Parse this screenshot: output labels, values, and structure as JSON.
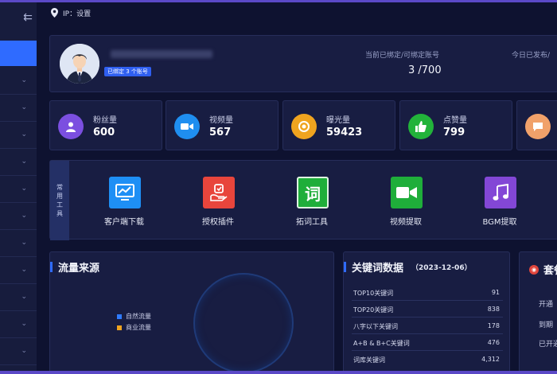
{
  "breadcrumb": {
    "text": "IP：设置"
  },
  "profile": {
    "bound_badge": "已绑定 3 个账号",
    "bind_label": "当前已绑定/可绑定账号",
    "bind_value": "3 /700",
    "today_label": "今日已发布/"
  },
  "stats": [
    {
      "label": "粉丝量",
      "value": "600",
      "color": "#7b4fe0",
      "icon": "user-icon"
    },
    {
      "label": "视频量",
      "value": "567",
      "color": "#1f8ef0",
      "icon": "video-camera-icon"
    },
    {
      "label": "曝光量",
      "value": "59423",
      "color": "#f0a41f",
      "icon": "exposure-icon"
    },
    {
      "label": "点赞量",
      "value": "799",
      "color": "#22b33a",
      "icon": "thumbs-up-icon"
    },
    {
      "label": "",
      "value": "",
      "color": "#f1a16a",
      "icon": "comment-icon"
    }
  ],
  "tools": {
    "tag": [
      "常",
      "用",
      "工",
      "具"
    ],
    "items": [
      {
        "label": "客户端下载",
        "color": "#1e8ff5",
        "icon": "chart-monitor-icon"
      },
      {
        "label": "授权插件",
        "color": "#e8453c",
        "icon": "hand-authorize-icon"
      },
      {
        "label": "拓词工具",
        "color": "#1fae3a",
        "icon": "word-icon",
        "glyph": "词"
      },
      {
        "label": "视频提取",
        "color": "#1fae3a",
        "icon": "video-extract-icon"
      },
      {
        "label": "BGM提取",
        "color": "#8347d6",
        "icon": "music-note-icon"
      }
    ]
  },
  "traffic": {
    "title": "流量来源",
    "legend": [
      {
        "label": "自然流量",
        "color": "#2f7bff"
      },
      {
        "label": "商业流量",
        "color": "#f0a41f"
      }
    ]
  },
  "keywords": {
    "title": "关键词数据",
    "date": "（2023-12-06）",
    "rows": [
      {
        "label": "TOP10关键词",
        "value": "91"
      },
      {
        "label": "TOP20关键词",
        "value": "838"
      },
      {
        "label": "八字以下关键词",
        "value": "178"
      },
      {
        "label": "A+B & B+C关键词",
        "value": "476"
      },
      {
        "label": "词库关键词",
        "value": "4,312"
      }
    ]
  },
  "plan": {
    "title": "套餐",
    "lines": [
      "开通",
      "到期",
      "已开通"
    ]
  }
}
